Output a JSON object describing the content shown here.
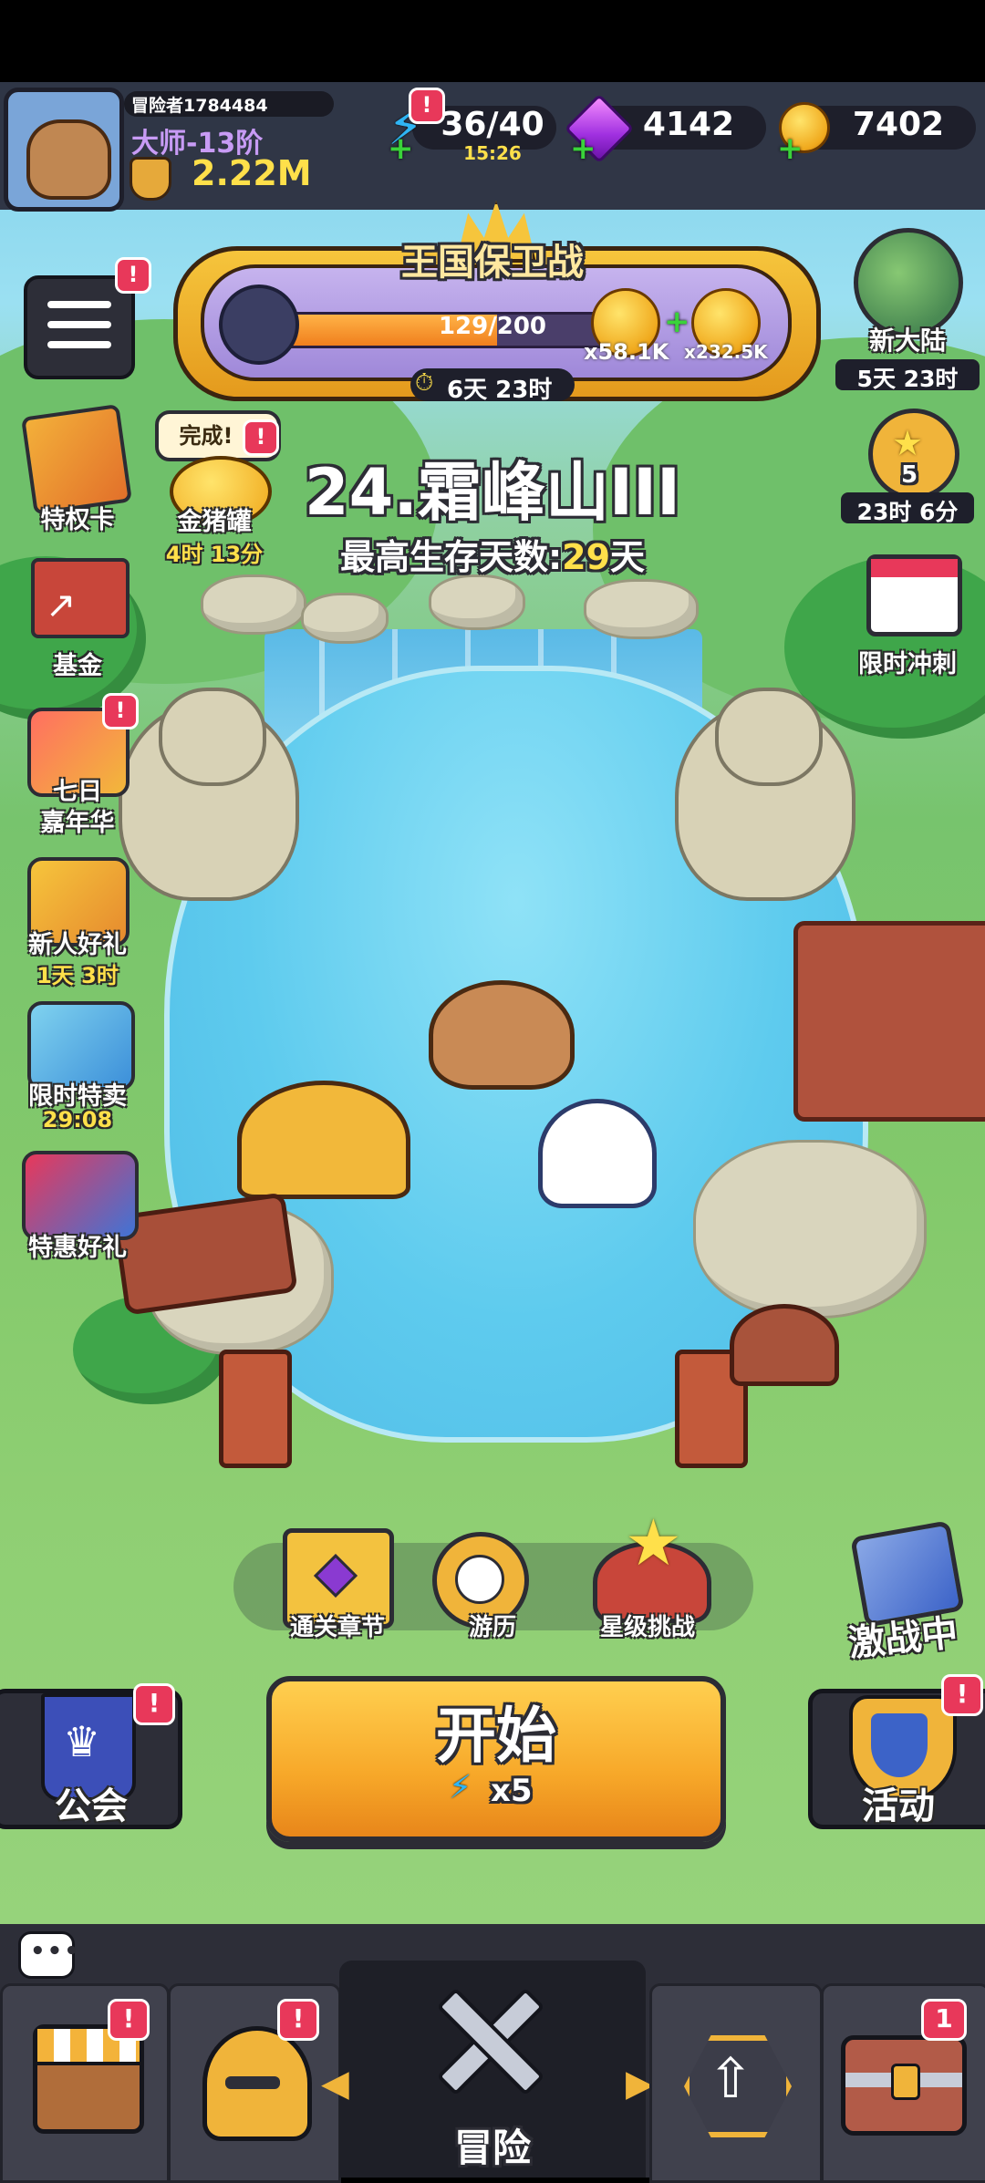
{
  "player": {
    "id_label": "冒险者1784484",
    "rank": "大师-13阶",
    "power": "2.22M"
  },
  "resources": {
    "energy": "36/40",
    "energy_timer": "15:26",
    "gems": "4142",
    "gold": "7402"
  },
  "event_banner": {
    "title": "王国保卫战",
    "progress_text": "129/200",
    "progress": 0.645,
    "reward_1": "x58.1K",
    "reward_2": "x232.5K",
    "timer": "6天 23时"
  },
  "top_right": {
    "new_continent_label": "新大陆",
    "new_continent_timer": "5天 23时",
    "star_count": "5",
    "star_timer": "23时 6分",
    "sprint_label": "限时冲刺"
  },
  "left_icons": [
    {
      "label": "特权卡"
    },
    {
      "label": "基金"
    },
    {
      "label": "七日\n嘉年华"
    },
    {
      "label": "新人好礼",
      "timer": "1天 3时"
    },
    {
      "label": "限时特卖",
      "timer": "29:08"
    },
    {
      "label": "特惠好礼"
    }
  ],
  "piggy": {
    "bubble": "完成!",
    "label": "金猪罐",
    "timer": "4时 13分"
  },
  "stage": {
    "name": "24.霜峰山III",
    "survival_prefix": "最高生存天数:",
    "survival_days": "29",
    "survival_suffix": "天"
  },
  "modes": [
    {
      "label": "通关章节"
    },
    {
      "label": "游历"
    },
    {
      "label": "星级挑战"
    }
  ],
  "battle": {
    "label": "激战中"
  },
  "start": {
    "label": "开始",
    "cost": "x5"
  },
  "guild": {
    "label": "公会"
  },
  "activity": {
    "label": "活动"
  },
  "bottom_nav": {
    "adventure_label": "冒险",
    "chest_badge": "1"
  },
  "colors": {
    "accent": "#f7a829",
    "alert": "#e8385a",
    "highlight": "#ffe04a"
  }
}
